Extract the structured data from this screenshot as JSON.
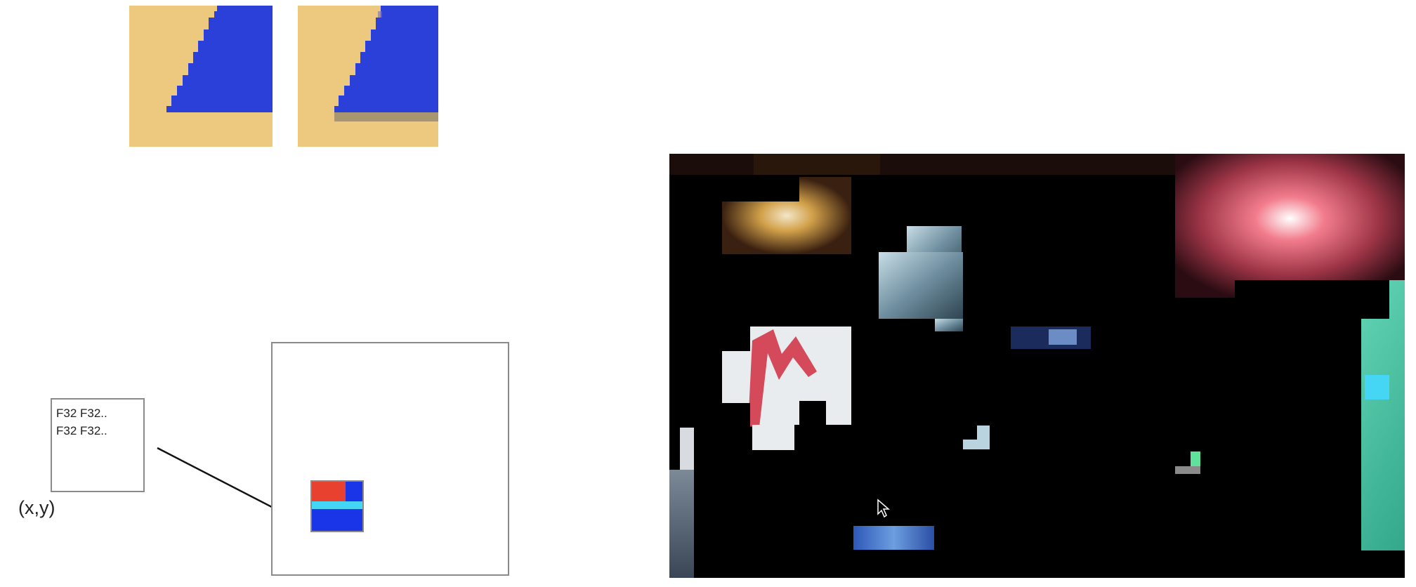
{
  "texel_box": {
    "lines": [
      "F32 F32..",
      "F32 F32.."
    ]
  },
  "coordinate_label": "(x,y)",
  "colors": {
    "tile_background": "#edc97f",
    "triangle_fill": "#2b3fd9",
    "shadow_fill": "#a89670",
    "cell_red": "#e8412f",
    "cell_cyan": "#46d6f5",
    "cell_blue": "#1a34e8",
    "frame_border": "#8a8a8a",
    "scene_background": "#000000"
  },
  "icons": {
    "cursor": "mouse-pointer-icon"
  }
}
